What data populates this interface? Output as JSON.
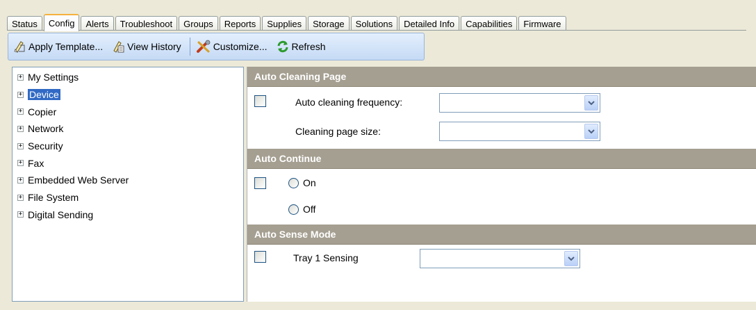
{
  "tabs": [
    {
      "label": "Status"
    },
    {
      "label": "Config",
      "active": true
    },
    {
      "label": "Alerts"
    },
    {
      "label": "Troubleshoot"
    },
    {
      "label": "Groups"
    },
    {
      "label": "Reports"
    },
    {
      "label": "Supplies"
    },
    {
      "label": "Storage"
    },
    {
      "label": "Solutions"
    },
    {
      "label": "Detailed Info"
    },
    {
      "label": "Capabilities"
    },
    {
      "label": "Firmware"
    }
  ],
  "toolbar": {
    "apply_template": "Apply Template...",
    "view_history": "View History",
    "customize": "Customize...",
    "refresh": "Refresh"
  },
  "tree": {
    "selected": "Device",
    "items": [
      {
        "label": "My Settings"
      },
      {
        "label": "Device"
      },
      {
        "label": "Copier"
      },
      {
        "label": "Network"
      },
      {
        "label": "Security"
      },
      {
        "label": "Fax"
      },
      {
        "label": "Embedded Web Server"
      },
      {
        "label": "File System"
      },
      {
        "label": "Digital Sending"
      }
    ]
  },
  "sections": {
    "auto_cleaning": {
      "title": "Auto Cleaning Page",
      "frequency_label": "Auto cleaning frequency:",
      "frequency_value": "",
      "size_label": "Cleaning page size:",
      "size_value": ""
    },
    "auto_continue": {
      "title": "Auto Continue",
      "on_label": "On",
      "off_label": "Off"
    },
    "auto_sense": {
      "title": "Auto Sense Mode",
      "tray_label": "Tray 1 Sensing",
      "tray_value": ""
    }
  },
  "icons": {
    "apply_template": "template-icon",
    "view_history": "history-icon",
    "customize": "customize-icon",
    "refresh": "refresh-icon",
    "expand": "plus-expander-icon",
    "dropdown": "chevron-down-icon"
  },
  "colors": {
    "section_header": "#a59f91",
    "selection": "#316ac5",
    "active_tab_accent": "#f5b13c",
    "toolbar": "#c5daf5"
  }
}
